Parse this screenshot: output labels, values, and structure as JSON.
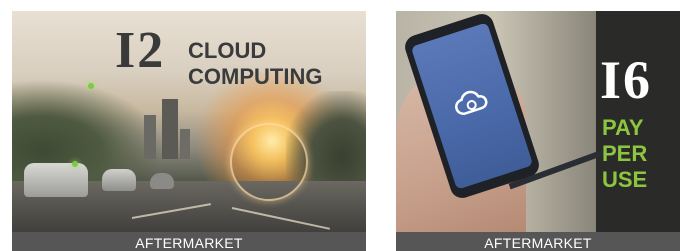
{
  "cards": [
    {
      "number": "I2",
      "title_lines": [
        "CLOUD",
        "COMPUTING"
      ],
      "caption": "AFTERMARKET",
      "colors": {
        "number": "#3a3a3a",
        "title": "#3b3b3b",
        "caption_bg": "#565657"
      }
    },
    {
      "number": "I6",
      "title_lines": [
        "PAY",
        "PER",
        "USE"
      ],
      "caption": "AFTERMARKET",
      "colors": {
        "number": "#ffffff",
        "title": "#8cc63f",
        "caption_bg": "#565657"
      }
    }
  ],
  "icons": {
    "phone_screen": "cloud-icon"
  }
}
